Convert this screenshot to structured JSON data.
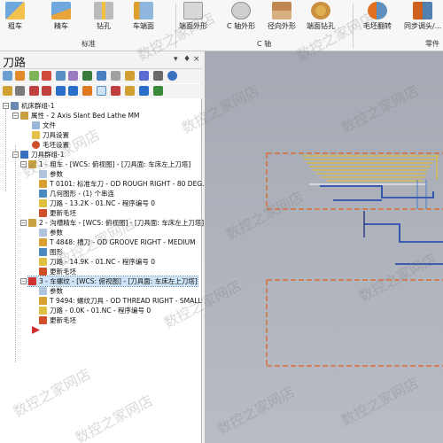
{
  "ribbon": {
    "buttons": [
      {
        "label": "粗车",
        "icon": "rough-turn-icon"
      },
      {
        "label": "精车",
        "icon": "finish-turn-icon"
      },
      {
        "label": "钻孔",
        "icon": "drill-icon"
      },
      {
        "label": "车端面",
        "icon": "face-turn-icon"
      },
      {
        "label": "端面外形",
        "icon": "face-contour-icon"
      },
      {
        "label": "C 轴外形",
        "icon": "c-axis-contour-icon"
      },
      {
        "label": "径向外形",
        "icon": "radial-contour-icon"
      },
      {
        "label": "端面钻孔",
        "icon": "face-drill-icon"
      },
      {
        "label": "毛坯翻转",
        "icon": "stock-flip-icon"
      },
      {
        "label": "同步调头/...",
        "icon": "sync-transfer-icon"
      }
    ],
    "groups": [
      "标准",
      "C 轴",
      "零件"
    ]
  },
  "panel": {
    "title": "刀路",
    "controls": {
      "pin": "▾",
      "dock": "♦",
      "close": "×"
    }
  },
  "tree": {
    "root": "机床群组-1",
    "properties": "属性 - 2 Axis Slant Bed Lathe MM",
    "files": "文件",
    "tool_settings": "刀具设置",
    "stock_settings": "毛坯设置",
    "toolpath_group": "刀具群组-1",
    "op1": {
      "title": "1 - 粗车 - [WCS: 俯视图] - [刀具面: 车床左上刀塔]",
      "params": "参数",
      "tool": "T 0101: 标准车刀 - OD ROUGH RIGHT - 80 DEG.",
      "geometry": "几何图形 - (1) 个串连",
      "path": "刀路 - 13.2K - 01.NC - 程序编号 0",
      "update": "更新毛坯"
    },
    "op2": {
      "title": "2 - 沟槽精车 - [WCS: 俯视图] - [刀具面: 车床左上刀塔]",
      "params": "参数",
      "tool": "T 4848: 槽刀 - OD GROOVE RIGHT - MEDIUM",
      "geometry": "图形",
      "path": "刀路 - 14.9K - 01.NC - 程序编号 0",
      "update": "更新毛坯"
    },
    "op3": {
      "title": "3 - 车螺纹 - [WCS: 俯视图] - [刀具面: 车床左上刀塔]",
      "params": "参数",
      "tool": "T 9494: 螺纹刀具 - OD THREAD RIGHT - SMALL",
      "path": "刀路 - 0.0K - 01.NC - 程序编号 0",
      "update": "更新毛坯"
    }
  },
  "watermark": "数控之家网店",
  "colors": {
    "accent": "#2a6fc9",
    "toolpath_yellow": "#e8c020",
    "stock_orange": "#e0601a",
    "contour_blue": "#1a3fb0"
  }
}
